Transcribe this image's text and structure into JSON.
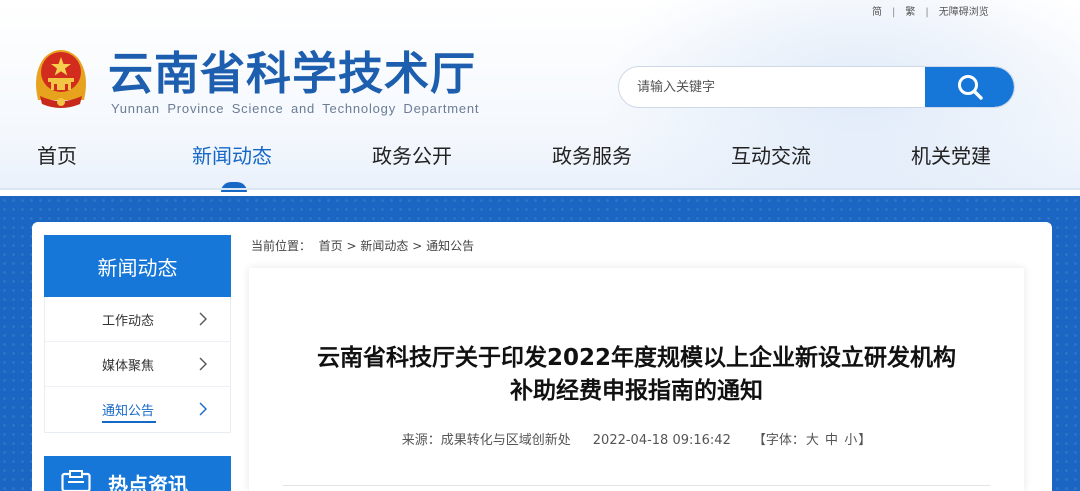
{
  "top_links": {
    "simplified": "简",
    "traditional": "繁",
    "accessibility": "无障碍浏览",
    "separator": "|"
  },
  "logo": {
    "name_cn": "云南省科学技术厅",
    "name_en": "Yunnan Province Science and Technology Department"
  },
  "search": {
    "placeholder": "请输入关键字"
  },
  "nav": {
    "items": [
      {
        "label": "首页"
      },
      {
        "label": "新闻动态"
      },
      {
        "label": "政务公开"
      },
      {
        "label": "政务服务"
      },
      {
        "label": "互动交流"
      },
      {
        "label": "机关党建"
      }
    ],
    "active_index": 1
  },
  "sidebar": {
    "title": "新闻动态",
    "items": [
      {
        "label": "工作动态"
      },
      {
        "label": "媒体聚焦"
      },
      {
        "label": "通知公告"
      }
    ],
    "active_index": 2,
    "hot_title": "热点资讯"
  },
  "breadcrumb": {
    "prefix": "当前位置：",
    "items": [
      {
        "label": "首页"
      },
      {
        "label": "新闻动态"
      },
      {
        "label": "通知公告"
      }
    ],
    "separator": ">"
  },
  "article": {
    "title_line1": "云南省科技厅关于印发2022年度规模以上企业新设立研发机构",
    "title_line2": "补助经费申报指南的通知",
    "source": "来源：成果转化与区域创新处",
    "datetime": "2022-04-18 09:16:42",
    "font_prefix": "【字体：",
    "font_large": "大",
    "font_medium": "中",
    "font_small": "小",
    "font_suffix": "】"
  },
  "colors": {
    "primary": "#1677d8",
    "nav_active": "#1668c7",
    "logo_text": "#1d5fae",
    "background_blue": "#1a66c2"
  },
  "icons": {
    "search": "search-icon",
    "emblem": "national-emblem",
    "chevron": "chevron-right-icon",
    "hot": "news-icon"
  }
}
